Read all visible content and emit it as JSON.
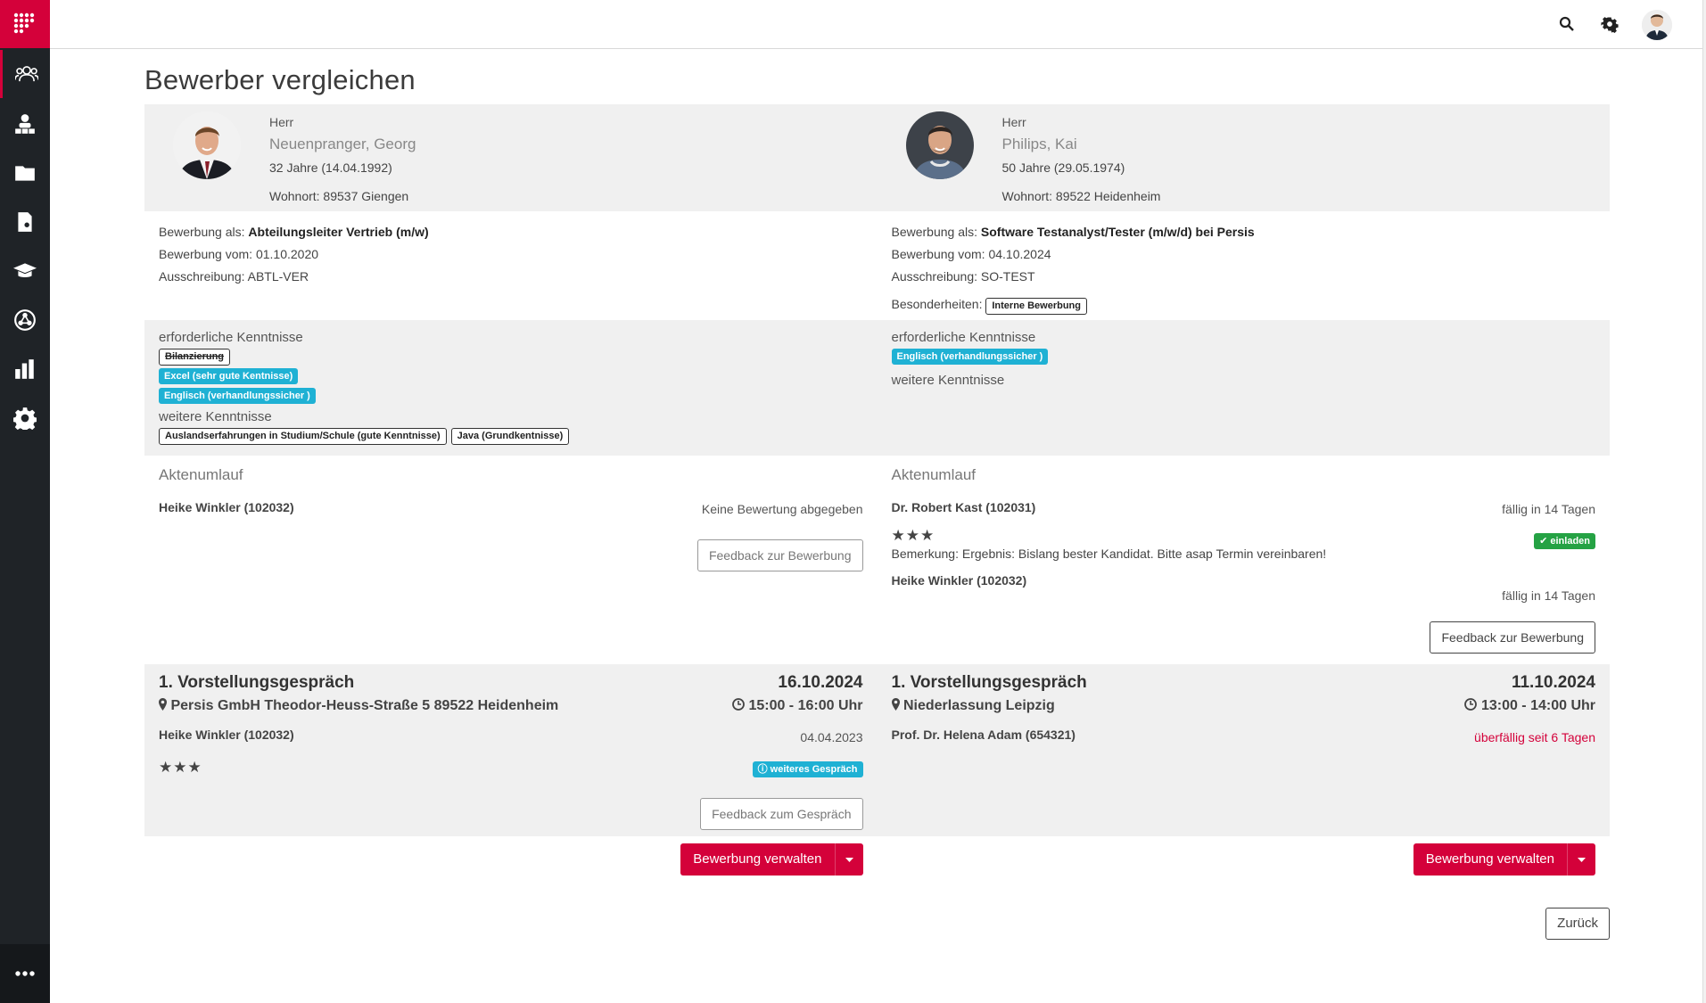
{
  "page": {
    "title": "Bewerber vergleichen"
  },
  "sidebar": {
    "items": [
      {
        "name": "bewerber",
        "icon": "users-icon",
        "active": true
      },
      {
        "name": "organisation",
        "icon": "org-icon"
      },
      {
        "name": "ordner",
        "icon": "folder-icon"
      },
      {
        "name": "dokumente",
        "icon": "document-icon"
      },
      {
        "name": "schulung",
        "icon": "graduation-cap-icon"
      },
      {
        "name": "netzwerk",
        "icon": "network-icon"
      },
      {
        "name": "statistik",
        "icon": "bar-chart-icon"
      },
      {
        "name": "einstellungen",
        "icon": "gear-icon"
      }
    ],
    "more": "more-icon"
  },
  "topbar": {
    "icons": [
      "search-icon",
      "gear-icon",
      "user-avatar"
    ]
  },
  "colors": {
    "brand": "#d4013a",
    "sidebar": "#1f2327",
    "cyan": "#1fb1d4",
    "green": "#25a244"
  },
  "left": {
    "salutation": "Herr",
    "name": "Neuenpranger, Georg",
    "age": "32 Jahre (14.04.1992)",
    "residence": "Wohnort: 89537 Giengen",
    "application_label": "Bewerbung als:",
    "application_title": "Abteilungsleiter Vertrieb (m/w)",
    "application_date": "Bewerbung vom: 01.10.2020",
    "tender": "Ausschreibung: ABTL-VER",
    "required_head": "erforderliche Kenntnisse",
    "required": [
      {
        "label": "Bilanzierung",
        "style": "strike"
      },
      {
        "label": "Excel (sehr gute Kentnisse)",
        "style": "cyan"
      },
      {
        "label": "Englisch (verhandlungssicher )",
        "style": "cyan"
      }
    ],
    "further_head": "weitere Kenntnisse",
    "further": [
      "Auslandserfahrungen in Studium/Schule (gute Kenntnisse)",
      "Java (Grundkentnisse)"
    ],
    "akten_title": "Aktenumlauf",
    "akten": [
      {
        "reviewer": "Heike Winkler (102032)",
        "status": "Keine Bewertung abgegeben"
      }
    ],
    "feedback_button": "Feedback zur Bewerbung",
    "interview": {
      "title": "1. Vorstellungsgespräch",
      "date": "16.10.2024",
      "location": "Persis GmbH Theodor-Heuss-Straße 5 89522 Heidenheim",
      "time": "15:00 - 16:00 Uhr",
      "person": "Heike Winkler (102032)",
      "person_date": "04.04.2023",
      "stars": 3,
      "badge": "weiteres Gespräch",
      "feedback_button": "Feedback zum Gespräch"
    },
    "manage_button": "Bewerbung verwalten"
  },
  "right": {
    "salutation": "Herr",
    "name": "Philips, Kai",
    "age": "50 Jahre (29.05.1974)",
    "residence": "Wohnort: 89522 Heidenheim",
    "application_label": "Bewerbung als:",
    "application_title": "Software Testanalyst/Tester (m/w/d) bei Persis",
    "application_date": "Bewerbung vom: 04.10.2024",
    "tender": "Ausschreibung: SO-TEST",
    "special_label": "Besonderheiten:",
    "special_tag": "Interne Bewerbung",
    "required_head": "erforderliche Kenntnisse",
    "required": [
      {
        "label": "Englisch (verhandlungssicher )",
        "style": "cyan"
      }
    ],
    "further_head": "weitere Kenntnisse",
    "akten_title": "Aktenumlauf",
    "akten": [
      {
        "reviewer": "Dr. Robert Kast (102031)",
        "status": "fällig in 14 Tagen",
        "stars": 3,
        "badge": "einladen",
        "remark": "Bemerkung: Ergebnis: Bislang bester Kandidat. Bitte asap Termin vereinbaren!"
      },
      {
        "reviewer": "Heike Winkler (102032)",
        "status": "fällig in 14 Tagen"
      }
    ],
    "feedback_button": "Feedback zur Bewerbung",
    "interview": {
      "title": "1. Vorstellungsgespräch",
      "date": "11.10.2024",
      "location": "Niederlassung Leipzig",
      "time": "13:00 - 14:00 Uhr",
      "person": "Prof. Dr. Helena Adam (654321)",
      "overdue": "überfällig seit 6 Tagen"
    },
    "manage_button": "Bewerbung verwalten"
  },
  "back_button": "Zurück"
}
